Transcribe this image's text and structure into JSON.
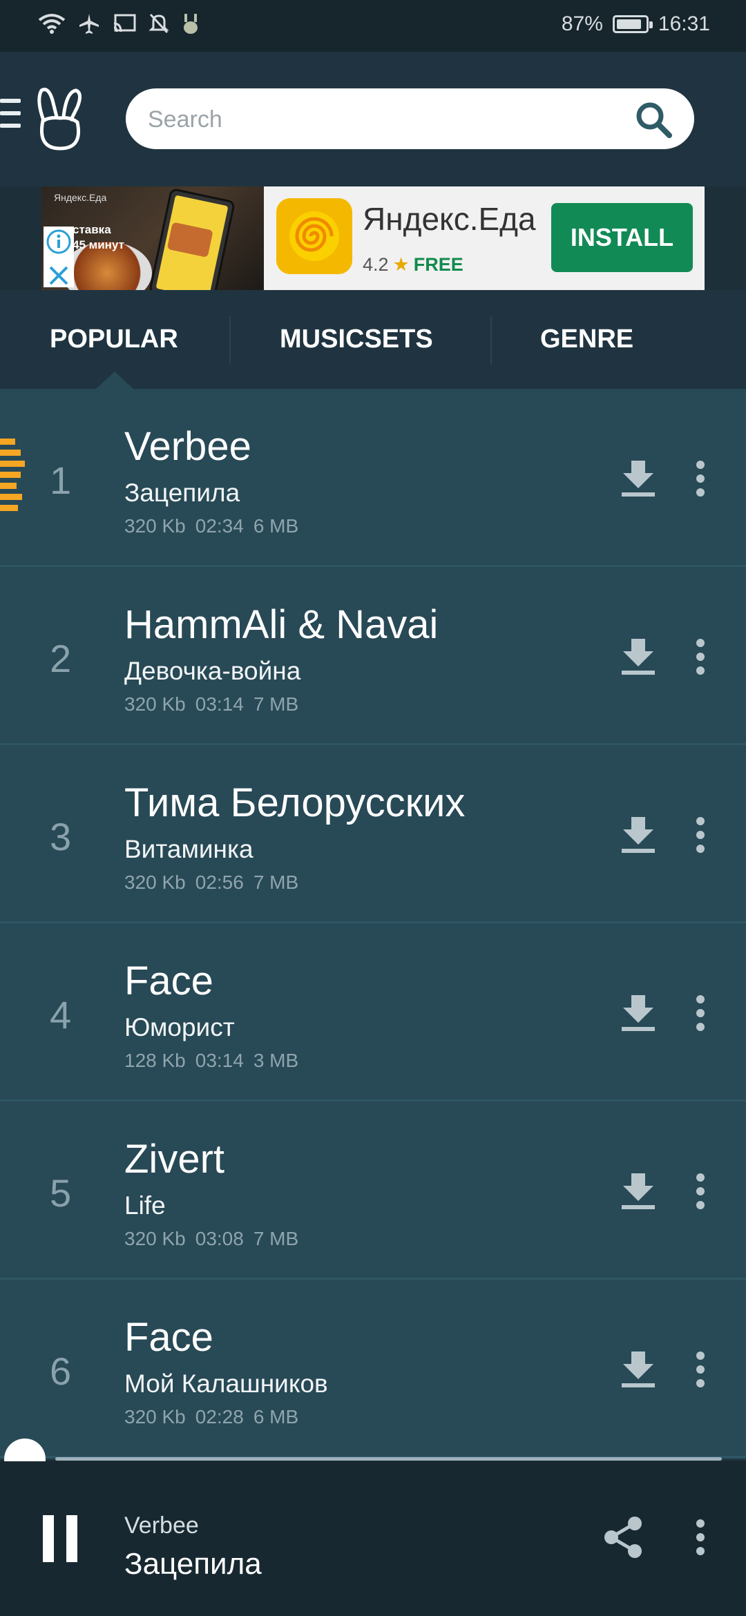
{
  "status_bar": {
    "battery": "87%",
    "time": "16:31",
    "battery_level": 0.87
  },
  "search": {
    "placeholder": "Search"
  },
  "ad": {
    "brand_small": "Яндекс.Еда",
    "promo_line1": "ставка",
    "promo_line2": "45 минут",
    "app_name": "Яндекс.Еда",
    "rating": "4.2",
    "price": "FREE",
    "install": "INSTALL"
  },
  "tabs": [
    {
      "label": "POPULAR",
      "active": true
    },
    {
      "label": "MUSICSETS",
      "active": false
    },
    {
      "label": "GENRE",
      "active": false
    }
  ],
  "tracks": [
    {
      "num": "1",
      "artist": "Verbee",
      "title": "Зацепила",
      "bitrate": "320 Kb",
      "duration": "02:34",
      "size": "6 MB",
      "playing": true
    },
    {
      "num": "2",
      "artist": "HammAli & Navai",
      "title": "Девочка-война",
      "bitrate": "320 Kb",
      "duration": "03:14",
      "size": "7 MB"
    },
    {
      "num": "3",
      "artist": "Тима Белорусских",
      "title": "Витаминка",
      "bitrate": "320 Kb",
      "duration": "02:56",
      "size": "7 MB"
    },
    {
      "num": "4",
      "artist": "Face",
      "title": "Юморист",
      "bitrate": "128 Kb",
      "duration": "03:14",
      "size": "3 MB"
    },
    {
      "num": "5",
      "artist": "Zivert",
      "title": "Life",
      "bitrate": "320 Kb",
      "duration": "03:08",
      "size": "7 MB"
    },
    {
      "num": "6",
      "artist": "Face",
      "title": "Мой Калашников",
      "bitrate": "320 Kb",
      "duration": "02:28",
      "size": "6 MB"
    }
  ],
  "player": {
    "artist": "Verbee",
    "title": "Зацепила",
    "progress": 0.0
  },
  "colors": {
    "accent_eq": "#f5a623",
    "list_bg": "#284956",
    "install_green": "#128a56"
  }
}
